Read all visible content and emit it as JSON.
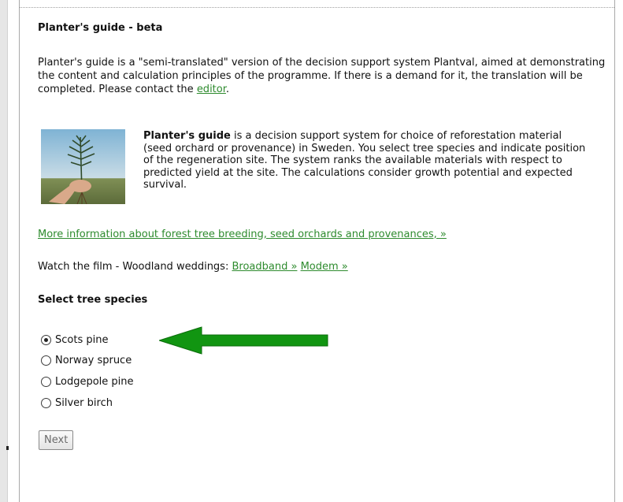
{
  "page": {
    "title": "Planter's guide - beta"
  },
  "intro": {
    "text": "Planter's guide is a \"semi-translated\" version of the decision support system Plantval, aimed at demonstrating the content and calculation principles of the programme. If there is a demand for it, the translation will be completed. Please contact the ",
    "editor_link": "editor",
    "suffix": "."
  },
  "description": {
    "bold": "Planter's guide",
    "text": " is a decision support system for choice of reforestation material (seed orchard or provenance) in Sweden. You select tree species and indicate position of the regeneration site. The system ranks the available materials with respect to predicted yield at the site. The calculations consider growth potential and expected survival."
  },
  "links": {
    "more_info": "More information about forest tree breeding, seed orchards and provenances, »"
  },
  "film": {
    "label": "Watch the film - Woodland weddings: ",
    "broadband": "Broadband »",
    "modem": "Modem »"
  },
  "species": {
    "heading": "Select tree species",
    "options": [
      {
        "label": "Scots pine",
        "checked": true
      },
      {
        "label": "Norway spruce",
        "checked": false
      },
      {
        "label": "Lodgepole pine",
        "checked": false
      },
      {
        "label": "Silver birch",
        "checked": false
      }
    ]
  },
  "actions": {
    "next_label": "Next"
  },
  "colors": {
    "link": "#2e8b2e",
    "arrow": "#119511"
  }
}
